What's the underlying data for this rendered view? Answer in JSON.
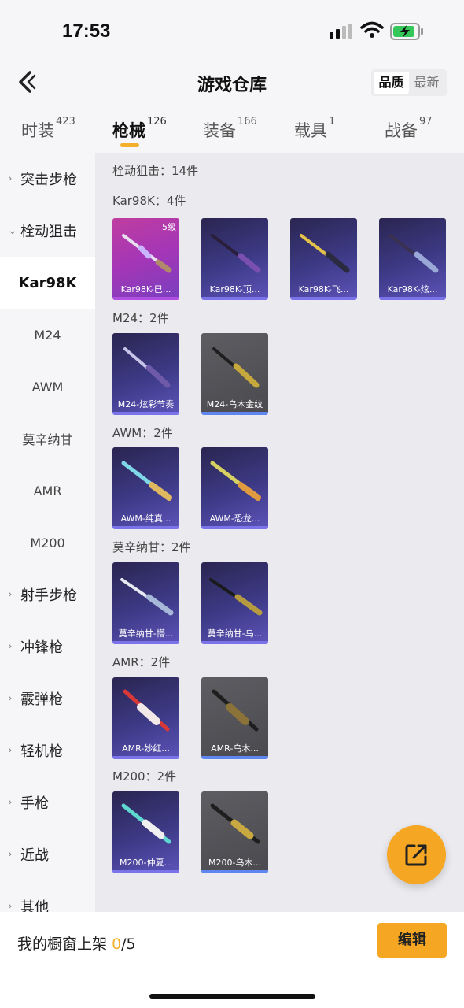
{
  "status": {
    "time": "17:53"
  },
  "header": {
    "title": "游戏仓库",
    "sort_quality": "品质",
    "sort_latest": "最新"
  },
  "tabs": [
    {
      "label": "时装",
      "count": "423"
    },
    {
      "label": "枪械",
      "count": "126"
    },
    {
      "label": "装备",
      "count": "166"
    },
    {
      "label": "载具",
      "count": "1"
    },
    {
      "label": "战备",
      "count": "97"
    }
  ],
  "sidebar": {
    "items": [
      {
        "label": "突击步枪"
      },
      {
        "label": "栓动狙击"
      },
      {
        "label": "Kar98K"
      },
      {
        "label": "M24"
      },
      {
        "label": "AWM"
      },
      {
        "label": "莫辛纳甘"
      },
      {
        "label": "AMR"
      },
      {
        "label": "M200"
      },
      {
        "label": "射手步枪"
      },
      {
        "label": "冲锋枪"
      },
      {
        "label": "霰弹枪"
      },
      {
        "label": "轻机枪"
      },
      {
        "label": "手枪"
      },
      {
        "label": "近战"
      },
      {
        "label": "其他"
      }
    ]
  },
  "main": {
    "total": "栓动狙击：14件",
    "sections": [
      {
        "title": "Kar98K：4件",
        "items": [
          {
            "name": "Kar98K-巳...",
            "level": "5级",
            "color": "#c03fa6"
          },
          {
            "name": "Kar98K-顶...",
            "color": "#3d3a86"
          },
          {
            "name": "Kar98K-飞...",
            "color": "#3d3a86"
          },
          {
            "name": "Kar98K-炫...",
            "color": "#3d3a86"
          }
        ]
      },
      {
        "title": "M24：2件",
        "items": [
          {
            "name": "M24-炫彩节奏",
            "color": "#3d3a86"
          },
          {
            "name": "M24-乌木金纹",
            "color": "#55555a"
          }
        ]
      },
      {
        "title": "AWM：2件",
        "items": [
          {
            "name": "AWM-纯真...",
            "color": "#3d3a86"
          },
          {
            "name": "AWM-恐龙...",
            "color": "#3d3a86"
          }
        ]
      },
      {
        "title": "莫辛纳甘：2件",
        "items": [
          {
            "name": "莫辛纳甘-懵...",
            "color": "#3d3a86"
          },
          {
            "name": "莫辛纳甘-乌...",
            "color": "#3d3a86"
          }
        ]
      },
      {
        "title": "AMR：2件",
        "items": [
          {
            "name": "AMR-妙红...",
            "color": "#3d3a86"
          },
          {
            "name": "AMR-乌木...",
            "color": "#55555a"
          }
        ]
      },
      {
        "title": "M200：2件",
        "items": [
          {
            "name": "M200-仲夏...",
            "color": "#3d3a86"
          },
          {
            "name": "M200-乌木...",
            "color": "#55555a"
          }
        ]
      }
    ]
  },
  "bottom": {
    "shelf_label": "我的橱窗上架",
    "shelf_count": "0",
    "shelf_total": "/5",
    "edit_label": "编辑"
  },
  "colors": {
    "accent": "#f5a623"
  }
}
